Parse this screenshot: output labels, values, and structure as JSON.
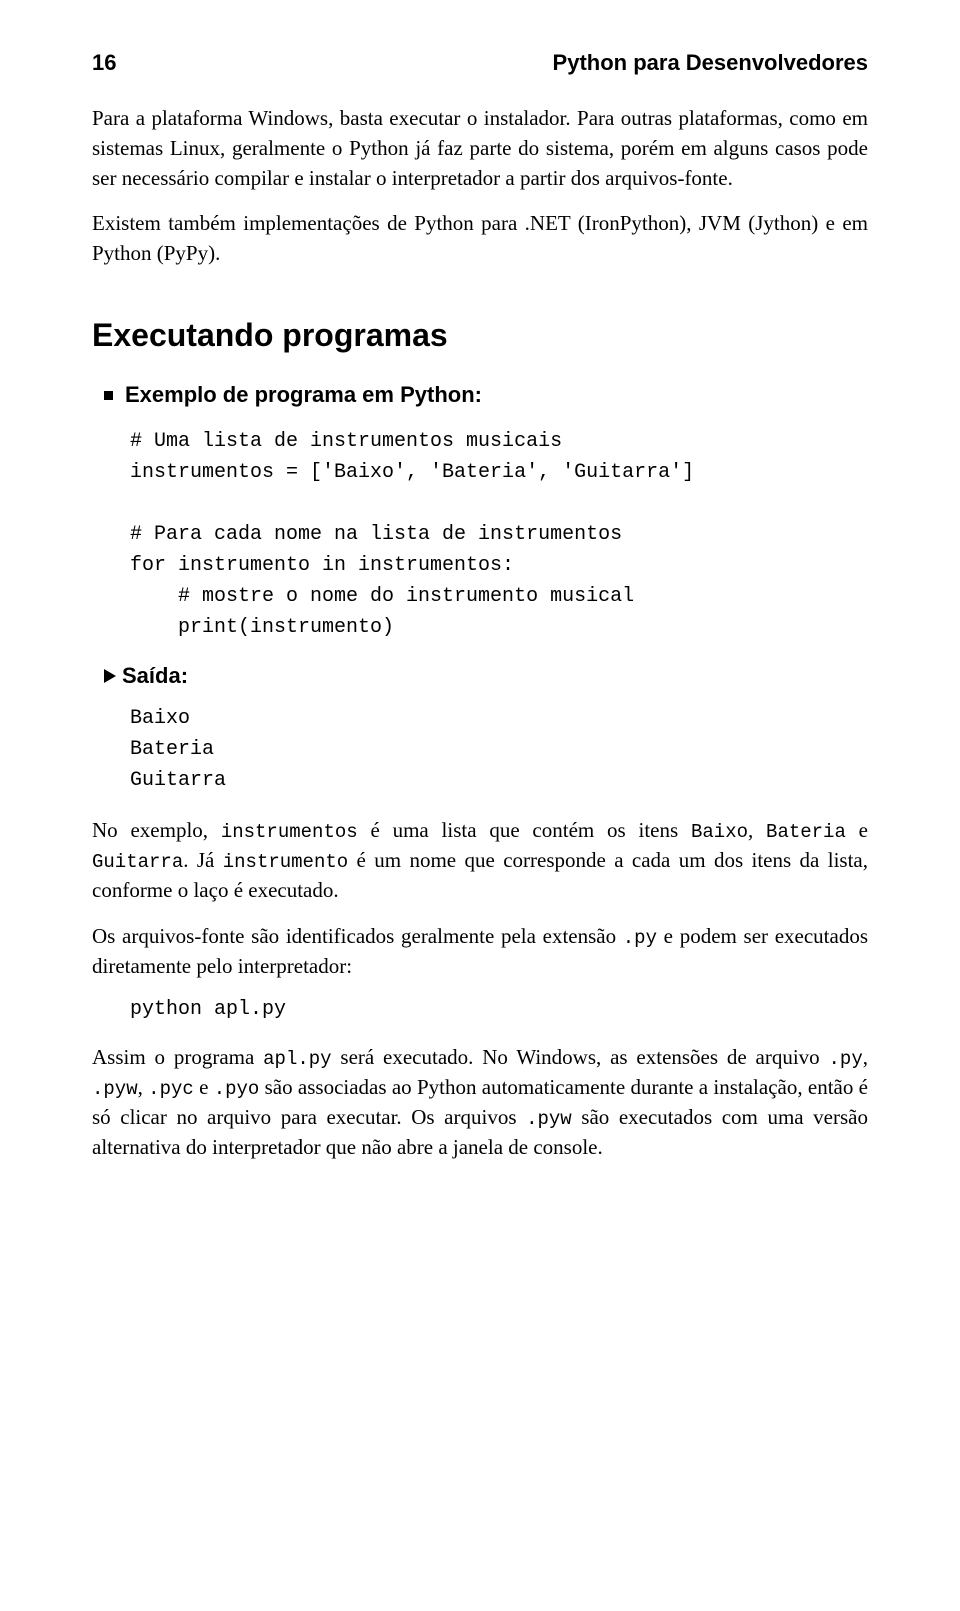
{
  "header": {
    "page_number": "16",
    "book_title": "Python para Desenvolvedores"
  },
  "para1": "Para a plataforma Windows, basta executar o instalador. Para outras plataformas, como em sistemas Linux, geralmente o Python já faz parte do sistema, porém em alguns casos pode ser necessário compilar e instalar o interpretador a partir dos arquivos-fonte.",
  "para2": "Existem também implementações de Python para .NET (IronPython), JVM (Jython) e em Python (PyPy).",
  "section_heading": "Executando programas",
  "example_label": "Exemplo de programa em Python:",
  "code_example": "# Uma lista de instrumentos musicais\ninstrumentos = ['Baixo', 'Bateria', 'Guitarra']\n\n# Para cada nome na lista de instrumentos\nfor instrumento in instrumentos:\n    # mostre o nome do instrumento musical\n    print(instrumento)",
  "saida_label": "Saída:",
  "output_block": "Baixo\nBateria\nGuitarra",
  "para3_parts": {
    "t1": "No exemplo, ",
    "m1": "instrumentos",
    "t2": " é uma lista que contém os itens ",
    "m2": "Baixo",
    "t3": ", ",
    "m3": "Bateria",
    "t4": " e ",
    "m4": "Guitarra",
    "t5": ". Já ",
    "m5": "instrumento",
    "t6": " é um nome que corresponde a cada um dos itens da lista, conforme o laço é executado."
  },
  "para4_parts": {
    "t1": "Os arquivos-fonte são identificados geralmente pela extensão ",
    "m1": ".py",
    "t2": " e podem ser executados diretamente pelo interpretador:"
  },
  "cmd": "python apl.py",
  "para5_parts": {
    "t1": "Assim o programa ",
    "m1": "apl.py",
    "t2": " será executado. No Windows, as extensões de arquivo ",
    "m2": ".py",
    "t3": ", ",
    "m3": ".pyw",
    "t4": ", ",
    "m4": ".pyc",
    "t5": " e ",
    "m5": ".pyo",
    "t6": " são associadas ao Python automaticamente durante a instalação, então é só clicar no arquivo para executar. Os arquivos ",
    "m6": ".pyw",
    "t7": " são executados com uma versão alternativa do interpretador que não abre a janela de console."
  }
}
